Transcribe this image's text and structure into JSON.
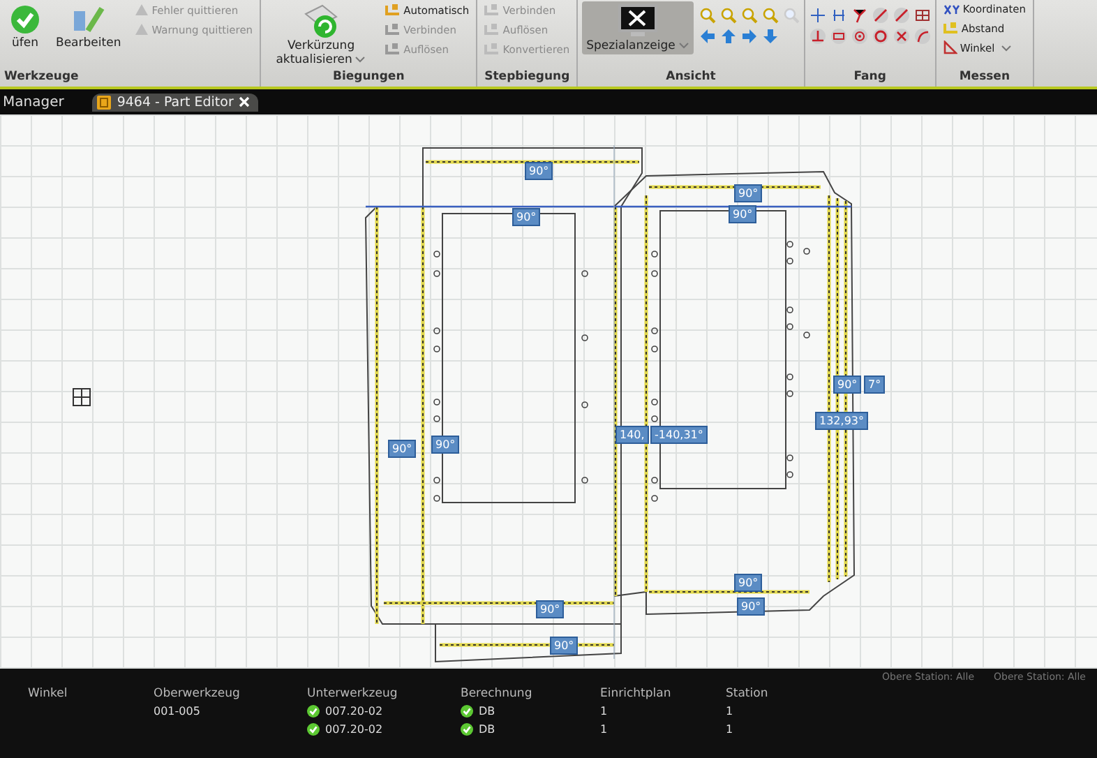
{
  "ribbon": {
    "groups": [
      {
        "label": "Werkzeuge",
        "kind": "buttons",
        "items": [
          {
            "kind": "large",
            "label": "üfen",
            "disabled": false
          },
          {
            "kind": "large",
            "label": "Bearbeiten",
            "disabled": false
          },
          {
            "kind": "small",
            "label": "Fehler quittieren",
            "disabled": true
          },
          {
            "kind": "small",
            "label": "Warnung quittieren",
            "disabled": true
          }
        ]
      },
      {
        "label": "Biegungen",
        "kind": "buttons",
        "items": [
          {
            "kind": "large",
            "label": "Verkürzung aktualisieren",
            "disabled": false,
            "dropdown": true
          },
          {
            "kind": "small",
            "label": "Automatisch",
            "disabled": false
          },
          {
            "kind": "small",
            "label": "Verbinden",
            "disabled": true
          },
          {
            "kind": "small",
            "label": "Auflösen",
            "disabled": true
          }
        ]
      },
      {
        "label": "Stepbiegung",
        "kind": "buttons",
        "items": [
          {
            "kind": "small",
            "label": "Verbinden",
            "disabled": true
          },
          {
            "kind": "small",
            "label": "Auflösen",
            "disabled": true
          },
          {
            "kind": "small",
            "label": "Konvertieren",
            "disabled": true
          }
        ]
      },
      {
        "label": "Ansicht",
        "kind": "view",
        "items": [
          {
            "kind": "large",
            "label": "Spezialanzeige",
            "disabled": false,
            "selected": true,
            "dropdown": true
          }
        ]
      },
      {
        "label": "Fang",
        "kind": "snap"
      },
      {
        "label": "Messen",
        "kind": "buttons",
        "items": [
          {
            "kind": "small",
            "label": "Koordinaten",
            "disabled": false
          },
          {
            "kind": "small",
            "label": "Abstand",
            "disabled": false
          },
          {
            "kind": "small",
            "label": "Winkel",
            "disabled": false,
            "dropdown": true
          }
        ]
      }
    ]
  },
  "tab_bar": {
    "manager": "Manager",
    "tabs": [
      {
        "label": "9464 - Part Editor",
        "selected": true
      }
    ]
  },
  "canvas": {
    "angle_labels": [
      "90°",
      "90°",
      "90°",
      "90°",
      "90°",
      "90°",
      "140,",
      "-140,31°",
      "90°",
      "7°",
      "132,93°",
      "90°",
      "90°",
      "90°",
      "90°"
    ]
  },
  "bottom_panel": {
    "filters": [
      "Obere Station: Alle",
      "Obere Station: Alle"
    ],
    "columns": [
      "Winkel",
      "Oberwerkzeug",
      "Unterwerkzeug",
      "Berechnung",
      "Einrichtplan",
      "Station"
    ],
    "rows": [
      {
        "oberwerkzeug": "001-005",
        "unterwerkzeug": "007.20-02",
        "unter_ok": true,
        "berechnung": "DB",
        "berechnung_ok": true,
        "einrichtplan": "1",
        "station": "1"
      },
      {
        "unterwerkzeug": "007.20-02",
        "unter_ok": true,
        "berechnung": "DB",
        "berechnung_ok": true,
        "einrichtplan": "1",
        "station": "1"
      }
    ]
  }
}
